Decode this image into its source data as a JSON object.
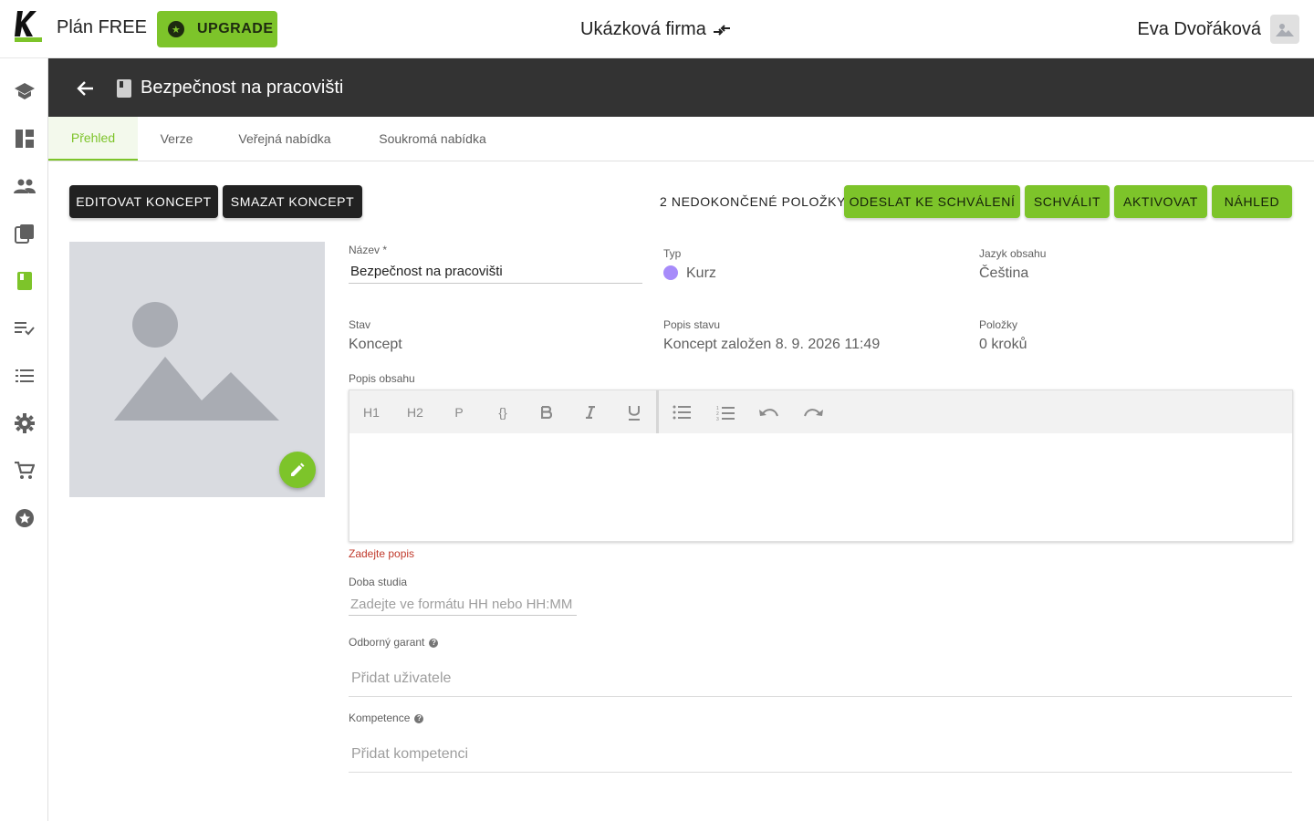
{
  "topbar": {
    "plan": "Plán FREE",
    "upgrade_label": "UPGRADE",
    "company": "Ukázková firma",
    "user": "Eva Dvořáková"
  },
  "sidebar": {
    "items": [
      {
        "icon": "school-icon"
      },
      {
        "icon": "dashboard-icon"
      },
      {
        "icon": "people-icon"
      },
      {
        "icon": "library-icon"
      },
      {
        "icon": "book-icon",
        "active": true
      },
      {
        "icon": "checklist-icon"
      },
      {
        "icon": "list-icon"
      },
      {
        "icon": "gear-icon"
      },
      {
        "icon": "cart-icon"
      },
      {
        "icon": "star-icon"
      }
    ],
    "active_color": "#7dc42a"
  },
  "header": {
    "title": "Bezpečnost na pracovišti"
  },
  "tabs": [
    {
      "label": "Přehled",
      "active": true
    },
    {
      "label": "Verze"
    },
    {
      "label": "Veřejná nabídka"
    },
    {
      "label": "Soukromá nabídka"
    }
  ],
  "actions": {
    "edit_draft": "EDITOVAT KONCEPT",
    "delete_draft": "SMAZAT KONCEPT",
    "pending": "2 NEDOKONČENÉ POLOŽKY",
    "submit": "ODESLAT KE SCHVÁLENÍ",
    "approve": "SCHVÁLIT",
    "activate": "AKTIVOVAT",
    "preview": "NÁHLED"
  },
  "details": {
    "name_label": "Název *",
    "name_value": "Bezpečnost na pracovišti",
    "type_label": "Typ",
    "type_value": "Kurz",
    "type_color": "#a78bfa",
    "language_label": "Jazyk obsahu",
    "language_value": "Čeština",
    "state_label": "Stav",
    "state_value": "Koncept",
    "state_desc_label": "Popis stavu",
    "state_desc_value": "Koncept založen 8. 9. 2026 11:49",
    "items_label": "Položky",
    "items_value": "0 kroků"
  },
  "editor": {
    "label": "Popis obsahu",
    "toolbar": [
      "H1",
      "H2",
      "P",
      "{}"
    ],
    "error": "Zadejte popis"
  },
  "duration": {
    "label": "Doba studia",
    "placeholder": "Zadejte ve formátu HH nebo HH:MM"
  },
  "guarantor": {
    "label": "Odborný garant",
    "placeholder": "Přidat uživatele"
  },
  "competence": {
    "label": "Kompetence",
    "placeholder": "Přidat kompetenci"
  }
}
